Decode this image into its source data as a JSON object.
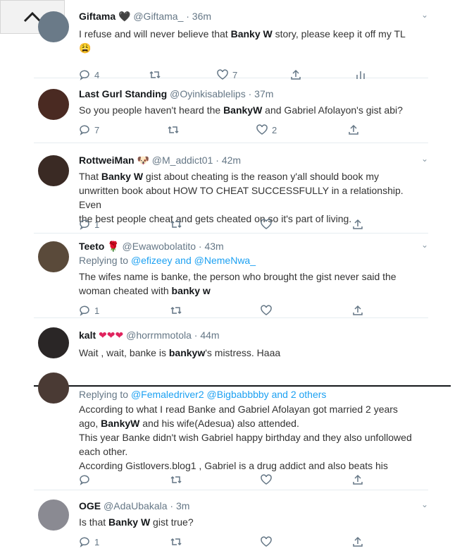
{
  "tweets": [
    {
      "name": "Giftama",
      "badge": "🖤",
      "handle": "@Giftama_",
      "time": "· 36m",
      "segments": [
        {
          "t": "I refuse and will never believe that "
        },
        {
          "t": "Banky W",
          "b": true
        },
        {
          "t": " story, please keep it off my TL"
        }
      ],
      "emoji": "😩",
      "replies": "4",
      "retweets": "",
      "likes": "7"
    },
    {
      "name": "Last Gurl Standing",
      "handle": "@Oyinkisablelips",
      "time": "· 37m",
      "segments": [
        {
          "t": "So you people haven't heard the "
        },
        {
          "t": "BankyW",
          "b": true
        },
        {
          "t": " and Gabriel Afolayon's  gist abi?"
        }
      ],
      "replies": "7",
      "retweets": "",
      "likes": "2"
    },
    {
      "name": "RottweiMan",
      "badge": "🐶",
      "handle": "@M_addict01",
      "time": "· 42m",
      "lines": [
        [
          {
            "t": "That "
          },
          {
            "t": "Banky W",
            "b": true
          },
          {
            "t": " gist about cheating is the reason y'all should book my"
          }
        ],
        [
          {
            "t": "unwritten book about HOW TO CHEAT SUCCESSFULLY in a relationship. Even"
          }
        ],
        [
          {
            "t": "the best people cheat and gets cheated on so it's part of living."
          }
        ]
      ],
      "replies": "1",
      "retweets": "",
      "likes": ""
    },
    {
      "name": "Teeto",
      "badge": "🌹",
      "handle": "@Ewawobolatito",
      "time": "· 43m",
      "replying_prefix": "Replying to ",
      "replying_to": "@efizeey and @NemeNwa_",
      "lines": [
        [
          {
            "t": "The wifes name is banke, the person who brought the gist never said the"
          }
        ],
        [
          {
            "t": "woman cheated with "
          },
          {
            "t": "banky w",
            "b": true
          }
        ]
      ],
      "replies": "1",
      "retweets": "",
      "likes": ""
    },
    {
      "name": "kalt",
      "badge": "❤❤❤",
      "handle": "@horrmmotola",
      "time": "· 44m",
      "segments": [
        {
          "t": "Wait , wait, banke is "
        },
        {
          "t": "bankyw",
          "b": true
        },
        {
          "t": "'s mistress. Haaa"
        }
      ]
    },
    {
      "replying_prefix": "Replying to ",
      "replying_to": "@Femaledriver2 @Bigbabbbby and 2 others",
      "lines": [
        [
          {
            "t": "According to what I read Banke and Gabriel Afolayan got married 2 years"
          }
        ],
        [
          {
            "t": "ago, "
          },
          {
            "t": "BankyW",
            "b": true
          },
          {
            "t": " and his wife(Adesua) also attended."
          }
        ],
        [
          {
            "t": "This year Banke didn't wish Gabriel happy birthday and they also unfollowed"
          }
        ],
        [
          {
            "t": "each other."
          }
        ],
        [
          {
            "t": "According Gistlovers.blog1 , Gabriel is a drug addict and also beats his"
          }
        ]
      ],
      "replies": "",
      "retweets": "",
      "likes": ""
    },
    {
      "name": "OGE",
      "handle": "@AdaUbakala",
      "time": "· 3m",
      "segments": [
        {
          "t": "Is that "
        },
        {
          "t": "Banky W",
          "b": true
        },
        {
          "t": " gist true?"
        }
      ],
      "replies": "1",
      "retweets": "",
      "likes": ""
    }
  ],
  "colors": {
    "link": "#1da1f2",
    "muted": "#657786",
    "heart": "#e0245e"
  },
  "icons": [
    "chevron-up-icon",
    "reply-icon",
    "retweet-icon",
    "like-icon",
    "share-icon",
    "analytics-icon",
    "chevron-down-icon"
  ]
}
